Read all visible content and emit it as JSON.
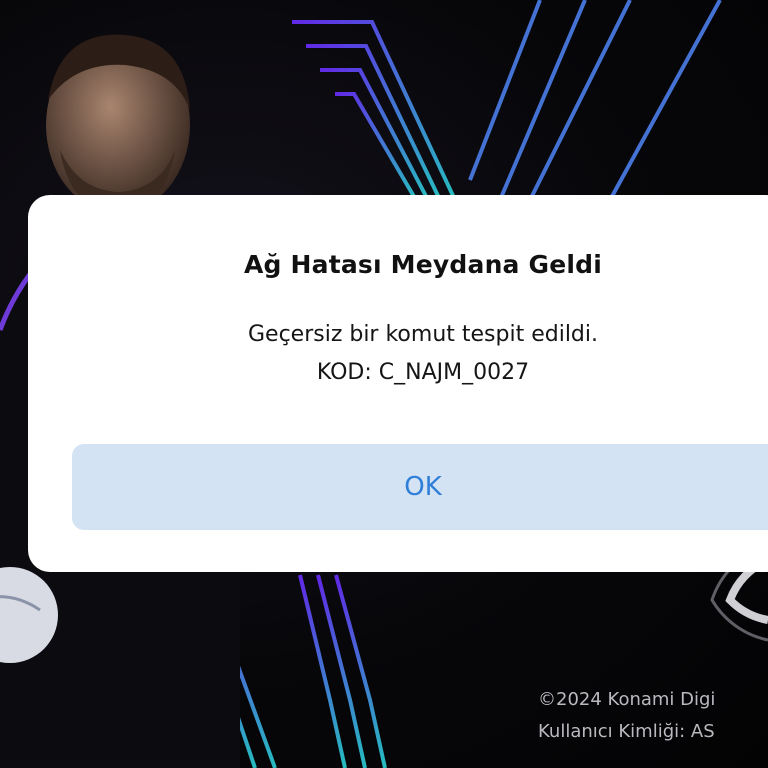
{
  "dialog": {
    "title": "Ağ Hatası Meydana Geldi",
    "message_line1": "Geçersiz bir komut tespit edildi.",
    "message_line2": "KOD: C_NAJM_0027",
    "ok_label": "OK"
  },
  "footer": {
    "copyright": "©2024 Konami Digi",
    "user_id": "Kullanıcı Kimliği: AS"
  },
  "colors": {
    "dialog_bg": "#ffffff",
    "button_bg": "#d4e3f4",
    "button_text": "#2f7fd8",
    "accent_purple": "#7a3cff",
    "accent_cyan": "#2fd6c9"
  }
}
